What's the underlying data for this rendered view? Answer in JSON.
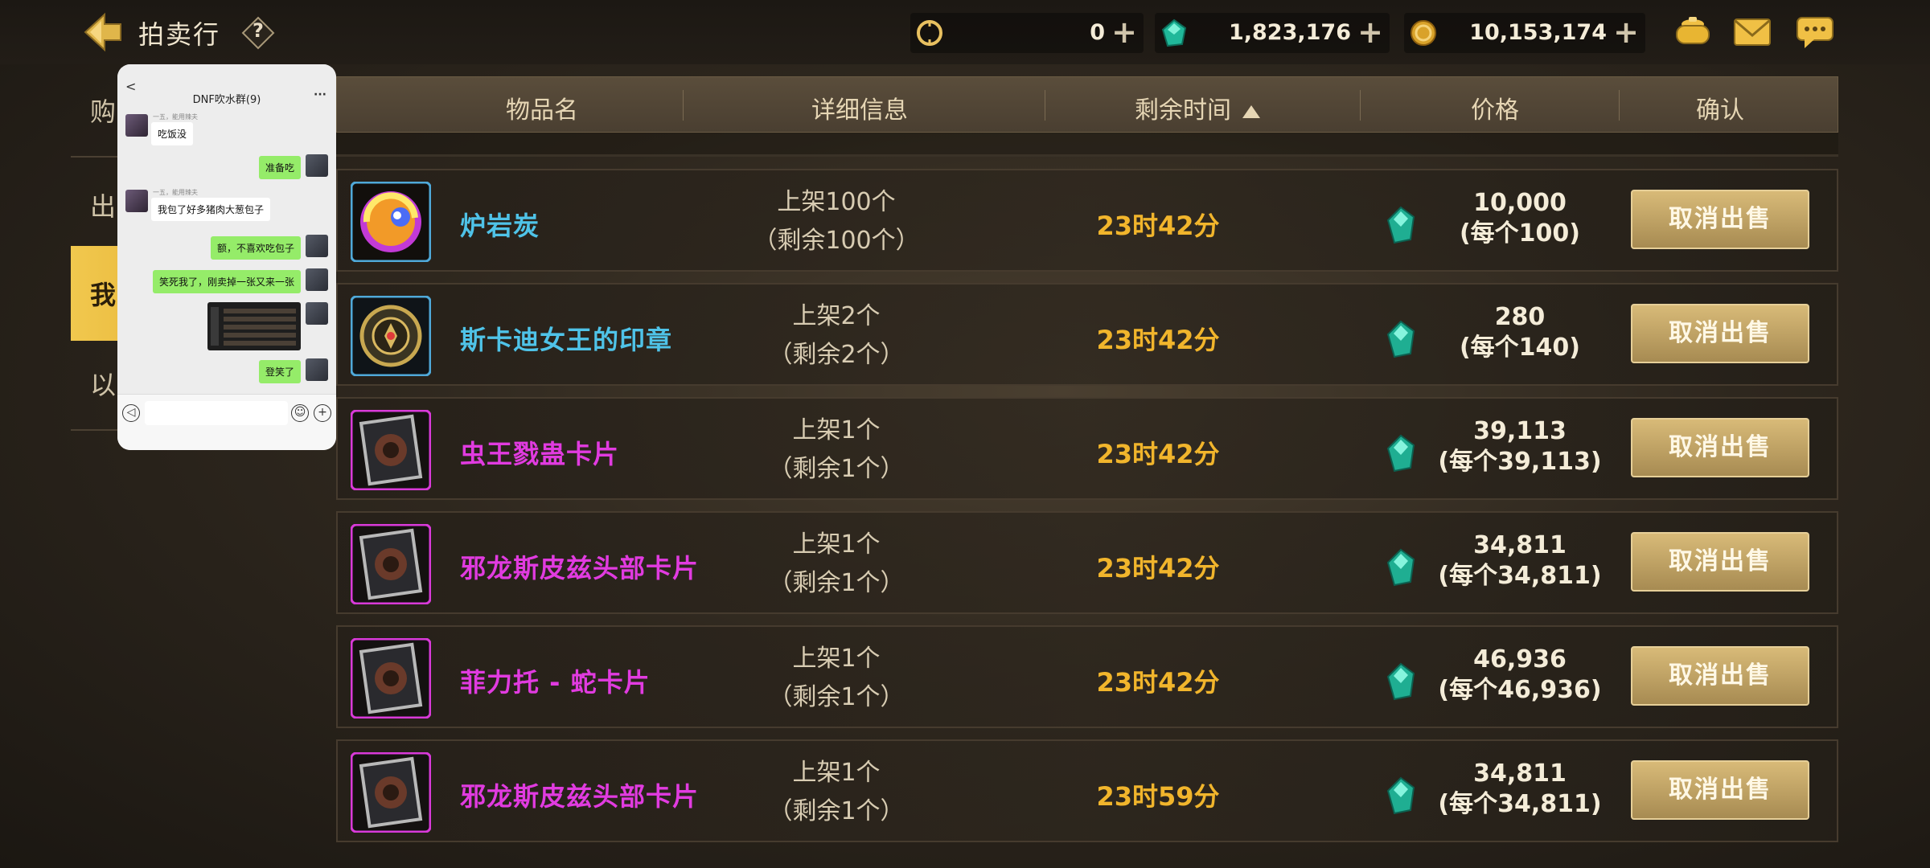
{
  "header": {
    "title": "拍卖行",
    "help": "?",
    "currencies": [
      {
        "icon": "c-coin-icon",
        "value": "0"
      },
      {
        "icon": "green-gem-icon",
        "value": "1,823,176"
      },
      {
        "icon": "gold-coin-icon",
        "value": "10,153,174"
      }
    ],
    "plus": "+"
  },
  "sidebar": {
    "tabs": [
      {
        "label": "购"
      },
      {
        "label": "出"
      },
      {
        "label": "我",
        "active": true
      },
      {
        "label": "以"
      }
    ]
  },
  "table": {
    "headers": {
      "item": "物品名",
      "detail": "详细信息",
      "time": "剩余时间",
      "price": "价格",
      "confirm": "确认"
    },
    "rows": [
      {
        "name": "炉岩炭",
        "color": "#4fc3e8",
        "detail1": "上架100个",
        "detail2": "（剩余100个）",
        "time": "23时42分",
        "price": "10,000",
        "unit": "(每个100)",
        "action": "取消出售",
        "icon": "lava-orb-icon"
      },
      {
        "name": "斯卡迪女王的印章",
        "color": "#4fc3e8",
        "detail1": "上架2个",
        "detail2": "（剩余2个）",
        "time": "23时42分",
        "price": "280",
        "unit": "(每个140)",
        "action": "取消出售",
        "icon": "seal-icon"
      },
      {
        "name": "虫王戮蛊卡片",
        "color": "#e13be0",
        "detail1": "上架1个",
        "detail2": "（剩余1个）",
        "time": "23时42分",
        "price": "39,113",
        "unit": "(每个39,113)",
        "action": "取消出售",
        "icon": "card-icon"
      },
      {
        "name": "邪龙斯皮兹头部卡片",
        "color": "#e13be0",
        "detail1": "上架1个",
        "detail2": "（剩余1个）",
        "time": "23时42分",
        "price": "34,811",
        "unit": "(每个34,811)",
        "action": "取消出售",
        "icon": "card-icon"
      },
      {
        "name": "菲力托 - 蛇卡片",
        "color": "#e13be0",
        "detail1": "上架1个",
        "detail2": "（剩余1个）",
        "time": "23时42分",
        "price": "46,936",
        "unit": "(每个46,936)",
        "action": "取消出售",
        "icon": "card-icon"
      },
      {
        "name": "邪龙斯皮兹头部卡片",
        "color": "#e13be0",
        "detail1": "上架1个",
        "detail2": "（剩余1个）",
        "time": "23时59分",
        "price": "34,811",
        "unit": "(每个34,811)",
        "action": "取消出售",
        "icon": "card-icon"
      }
    ]
  },
  "chat": {
    "title": "DNF吹水群(9)",
    "more": "···",
    "back": "<",
    "nick1": "一五，能用辣夫",
    "nick2": "一五，能用辣夫",
    "messages": [
      {
        "side": "l",
        "text": "吃饭没"
      },
      {
        "side": "r",
        "text": "准备吃"
      },
      {
        "side": "l",
        "text": "我包了好多猪肉大葱包子"
      },
      {
        "side": "r",
        "text": "额，不喜欢吃包子"
      },
      {
        "side": "r",
        "text": "笑死我了，刚卖掉一张又来一张"
      },
      {
        "side": "r",
        "text": "登笑了"
      }
    ]
  }
}
